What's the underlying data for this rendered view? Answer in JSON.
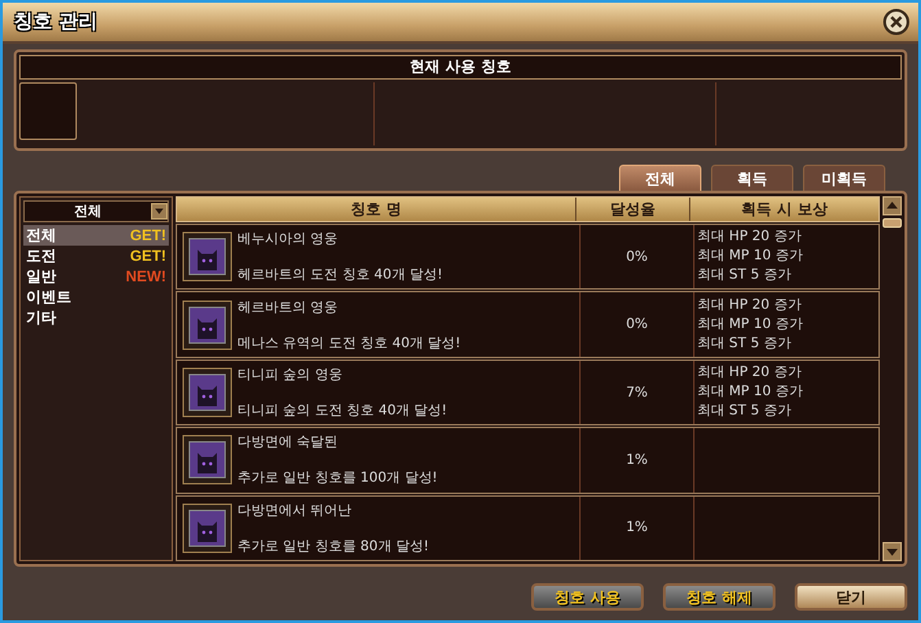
{
  "window": {
    "title": "칭호 관리"
  },
  "current_title": {
    "header": "현재 사용 칭호"
  },
  "tabs": [
    {
      "label": "전체",
      "selected": true
    },
    {
      "label": "획득",
      "selected": false
    },
    {
      "label": "미획득",
      "selected": false
    }
  ],
  "filter": {
    "value": "전체"
  },
  "categories": [
    {
      "label": "전체",
      "badge": "GET!",
      "color": "#f0c020",
      "selected": true
    },
    {
      "label": "도전",
      "badge": "GET!",
      "color": "#f0c020",
      "selected": false
    },
    {
      "label": "일반",
      "badge": "NEW!",
      "color": "#e04a20",
      "selected": false
    },
    {
      "label": "이벤트",
      "selected": false
    },
    {
      "label": "기타",
      "selected": false
    }
  ],
  "table": {
    "columns": [
      "칭호 명",
      "달성율",
      "획득 시 보상"
    ],
    "rows": [
      {
        "name": "베누시아의 영웅",
        "condition": "헤르바트의 도전 칭호 40개 달성!",
        "rate": "0%",
        "rewards": [
          "최대 HP 20 증가",
          "최대 MP 10 증가",
          "최대 ST 5 증가"
        ]
      },
      {
        "name": "헤르바트의 영웅",
        "condition": "메나스 유역의 도전 칭호 40개 달성!",
        "rate": "0%",
        "rewards": [
          "최대 HP 20 증가",
          "최대 MP 10 증가",
          "최대 ST 5 증가"
        ]
      },
      {
        "name": "티니피 숲의 영웅",
        "condition": "티니피 숲의 도전 칭호 40개 달성!",
        "rate": "7%",
        "rewards": [
          "최대 HP 20 증가",
          "최대 MP 10 증가",
          "최대 ST 5 증가"
        ]
      },
      {
        "name": "다방면에 숙달된",
        "condition": "추가로 일반 칭호를 100개 달성!",
        "rate": "1%"
      },
      {
        "name": "다방면에서 뛰어난",
        "condition": "추가로 일반 칭호를 80개 달성!",
        "rate": "1%"
      }
    ]
  },
  "buttons": [
    {
      "label": "칭호 사용",
      "highlighted": false
    },
    {
      "label": "칭호 해제",
      "highlighted": false
    },
    {
      "label": "닫기",
      "highlighted": true
    }
  ]
}
